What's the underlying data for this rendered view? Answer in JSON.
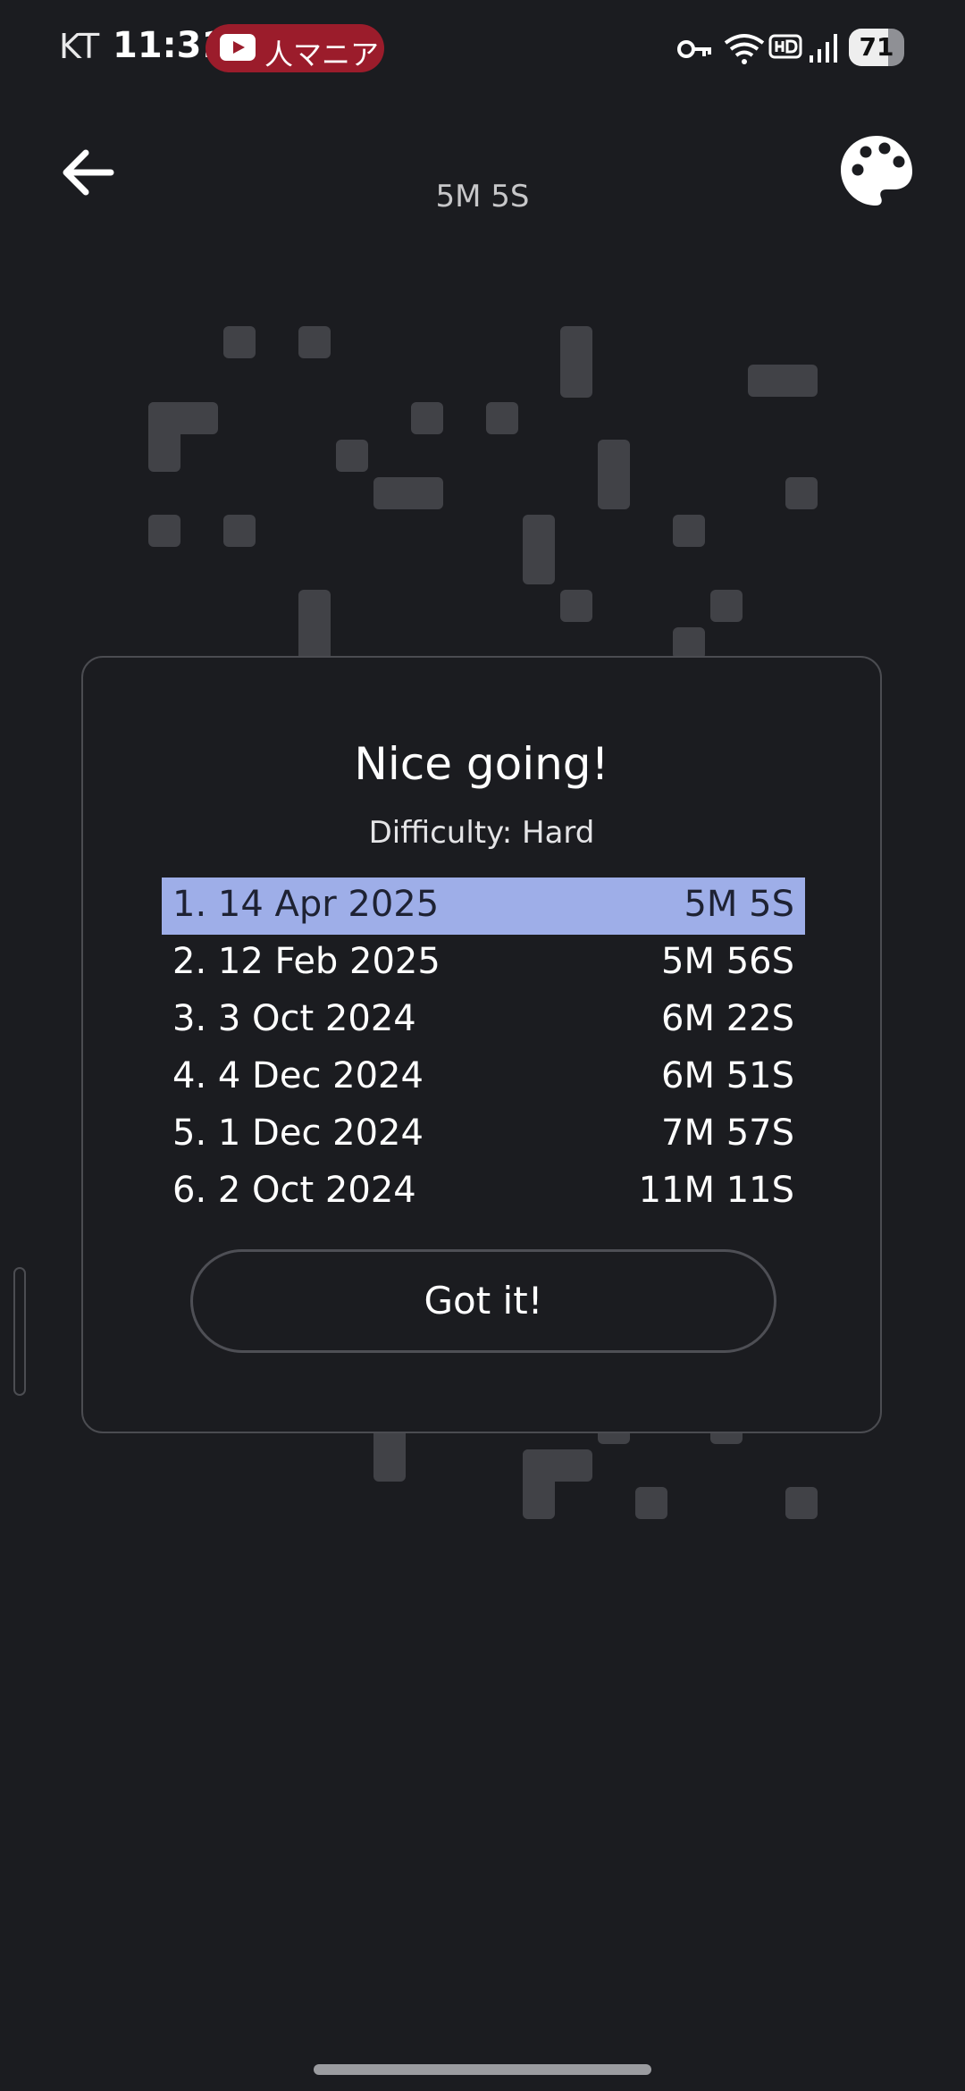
{
  "status_bar": {
    "carrier": "KT",
    "time": "11:31",
    "youtube_label": "人マニア",
    "battery": "71",
    "battery_level": 0.71
  },
  "timer": "5M 5S",
  "dialog": {
    "title": "Nice going!",
    "difficulty": "Difficulty: Hard",
    "scores": [
      {
        "label": "1. 14 Apr 2025",
        "time": "5M 5S",
        "current": true
      },
      {
        "label": "2. 12 Feb 2025",
        "time": "5M 56S",
        "current": false
      },
      {
        "label": "3. 3 Oct 2024",
        "time": "6M 22S",
        "current": false
      },
      {
        "label": "4. 4 Dec 2024",
        "time": "6M 51S",
        "current": false
      },
      {
        "label": "5. 1 Dec 2024",
        "time": "7M 57S",
        "current": false
      },
      {
        "label": "6. 2 Oct 2024",
        "time": "11M 11S",
        "current": false
      }
    ],
    "button": "Got it!"
  },
  "colors": {
    "background": "#1b1c20",
    "cell": "#414247",
    "highlight": "#9eaee8",
    "youtube_pill": "#9b1c2b"
  },
  "icons": {
    "back": "arrow-left-icon",
    "palette": "palette-icon",
    "youtube": "youtube-icon",
    "key": "vpn-key-icon",
    "wifi": "wifi-icon",
    "hd": "hd-voice-icon",
    "signal": "signal-icon",
    "battery": "battery-icon"
  }
}
